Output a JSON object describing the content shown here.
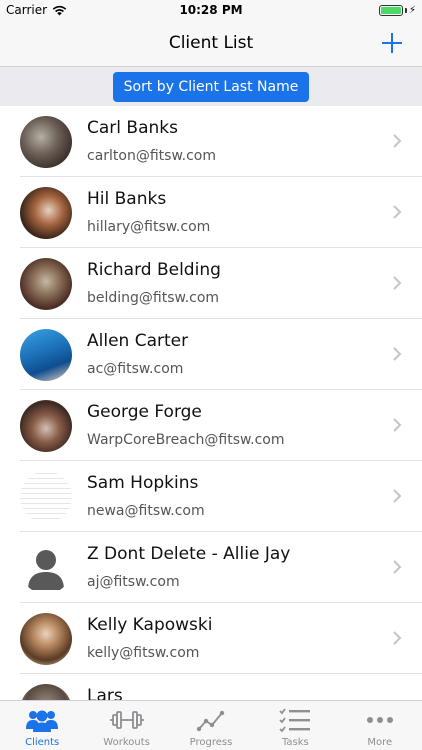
{
  "status_bar": {
    "carrier": "Carrier",
    "time": "10:28 PM"
  },
  "nav": {
    "title": "Client List",
    "add_icon": "plus-icon"
  },
  "sort_button": {
    "label": "Sort by Client Last Name"
  },
  "clients": [
    {
      "name": "Carl Banks",
      "email": "carlton@fitsw.com"
    },
    {
      "name": "Hil Banks",
      "email": "hillary@fitsw.com"
    },
    {
      "name": "Richard Belding",
      "email": "belding@fitsw.com"
    },
    {
      "name": "Allen Carter",
      "email": "ac@fitsw.com"
    },
    {
      "name": "George Forge",
      "email": "WarpCoreBreach@fitsw.com"
    },
    {
      "name": "Sam Hopkins",
      "email": "newa@fitsw.com"
    },
    {
      "name": "Z Dont Delete - Allie Jay",
      "email": "aj@fitsw.com"
    },
    {
      "name": "Kelly Kapowski",
      "email": "kelly@fitsw.com"
    },
    {
      "name": "Lars",
      "email": ""
    }
  ],
  "tabs": [
    {
      "label": "Clients",
      "icon": "clients-icon",
      "active": true
    },
    {
      "label": "Workouts",
      "icon": "dumbbell-icon",
      "active": false
    },
    {
      "label": "Progress",
      "icon": "progress-chart-icon",
      "active": false
    },
    {
      "label": "Tasks",
      "icon": "tasks-list-icon",
      "active": false
    },
    {
      "label": "More",
      "icon": "more-dots-icon",
      "active": false
    }
  ],
  "colors": {
    "accent": "#1a73e8",
    "inactive": "#8e8e93",
    "battery": "#4cd964"
  }
}
